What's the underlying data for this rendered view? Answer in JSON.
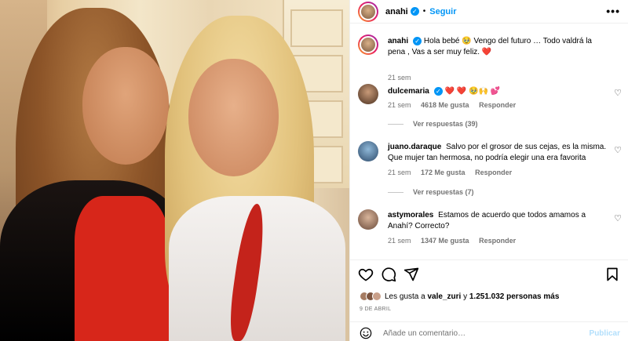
{
  "header": {
    "username": "anahi",
    "verified_icon": "verified-badge-icon",
    "separator": "•",
    "follow_label": "Seguir",
    "more_icon": "more-options-icon",
    "more_glyph": "•••"
  },
  "caption": {
    "username": "anahi",
    "text": "Hola bebé 🥹 Vengo del futuro … Todo valdrá la pena , Vas a ser muy feliz. ❤️",
    "time": "21 sem"
  },
  "comments": [
    {
      "username": "dulcemaria",
      "verified": true,
      "text": "❤️ ❤️ 🥹🙌 💕",
      "time": "21 sem",
      "likes": "4618 Me gusta",
      "reply_label": "Responder",
      "view_replies": "Ver respuestas (39)"
    },
    {
      "username": "juano.daraque",
      "verified": false,
      "text": "Salvo por el grosor de sus cejas, es la misma. Que mujer tan hermosa, no podría elegir una era favorita",
      "time": "21 sem",
      "likes": "172 Me gusta",
      "reply_label": "Responder",
      "view_replies": "Ver respuestas (7)"
    },
    {
      "username": "astymorales",
      "verified": false,
      "text": "Estamos de acuerdo que todos amamos a Anahí? Correcto?",
      "time": "21 sem",
      "likes": "1347 Me gusta",
      "reply_label": "Responder"
    }
  ],
  "actions": {
    "like_icon": "heart-icon",
    "comment_icon": "comment-icon",
    "share_icon": "share-icon",
    "save_icon": "bookmark-icon"
  },
  "likes": {
    "prefix": "Les gusta a",
    "user": "vale_zuri",
    "connector": "y",
    "count": "1.251.032 personas más"
  },
  "date": "9 DE ABRIL",
  "comment_bar": {
    "emoji_icon": "emoji-icon",
    "placeholder": "Añade un comentario…",
    "post_label": "Publicar"
  },
  "colors": {
    "accent": "#0095f6",
    "muted": "#737373",
    "heart_red": "#ed4956"
  }
}
